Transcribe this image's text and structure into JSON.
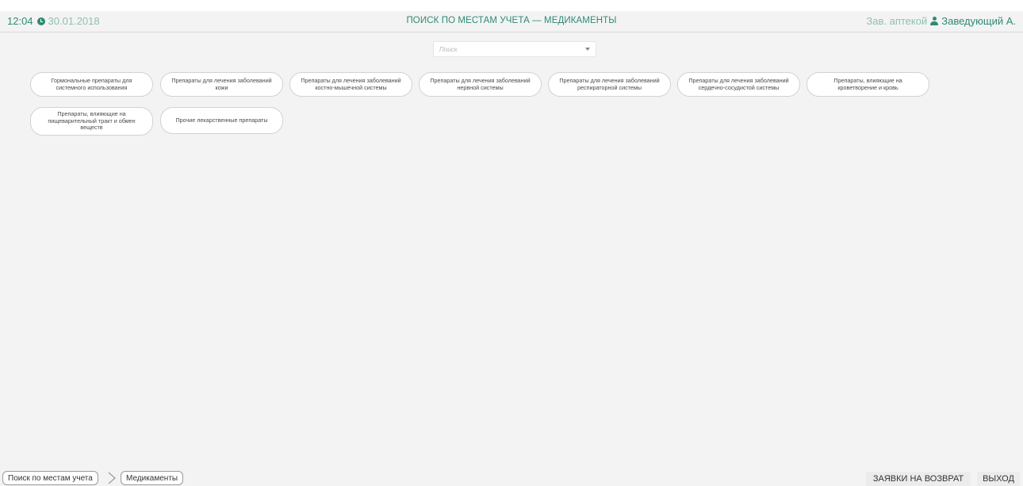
{
  "header": {
    "time": "12:04",
    "date": "30.01.2018",
    "title": "Поиск по местам учета — Медикаменты",
    "role": "Зав. аптекой",
    "user": "Заведующий А."
  },
  "search": {
    "placeholder": "Поиск",
    "value": ""
  },
  "categories": [
    "Гормональные препараты для системного использования",
    "Препараты для лечения заболеваний кожи",
    "Препараты для лечения заболеваний костно-мышечной системы",
    "Препараты для лечения заболеваний нервной системы",
    "Препараты для лечения заболеваний респираторной системы",
    "Препараты для лечения заболеваний сердечно-сосудистой системы",
    "Препараты, влияющие на кроветворение и кровь",
    "Препараты, влияющие на пищеварительный тракт и обмен веществ",
    "Прочие лекарственные препараты"
  ],
  "breadcrumb": [
    "Поиск по местам учета",
    "Медикаменты"
  ],
  "footer": {
    "returns_label": "ЗАЯВКИ НА ВОЗВРАТ",
    "exit_label": "ВЫХОД"
  },
  "colors": {
    "accent": "#2e8b74",
    "accent_light": "#8fbfb2",
    "background": "#f3f3f3"
  }
}
